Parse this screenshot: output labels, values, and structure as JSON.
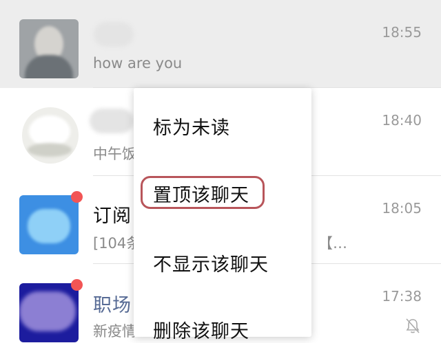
{
  "chats": [
    {
      "name": "",
      "preview": "how are you",
      "time": "18:55"
    },
    {
      "name": "",
      "preview": "中午饭",
      "time": "18:40"
    },
    {
      "name": "订阅",
      "preview": "[104条",
      "preview_tail": "【…",
      "time": "18:05"
    },
    {
      "name": "职场",
      "preview": "新疫情",
      "time": "17:38"
    }
  ],
  "context_menu": {
    "items": [
      {
        "label": "标为未读"
      },
      {
        "label": "置顶该聊天"
      },
      {
        "label": "不显示该聊天"
      },
      {
        "label": "删除该聊天"
      }
    ],
    "highlighted_index": 1
  },
  "colors": {
    "selected_row_bg": "#ededed",
    "badge": "#f25555",
    "highlight_outline": "#b8555a",
    "subscription_avatar": "#3d8fe3",
    "workplace_avatar": "#1c1c9e",
    "official_name_text": "#576b95"
  },
  "icons": {
    "mute": "bell-slash-icon"
  }
}
